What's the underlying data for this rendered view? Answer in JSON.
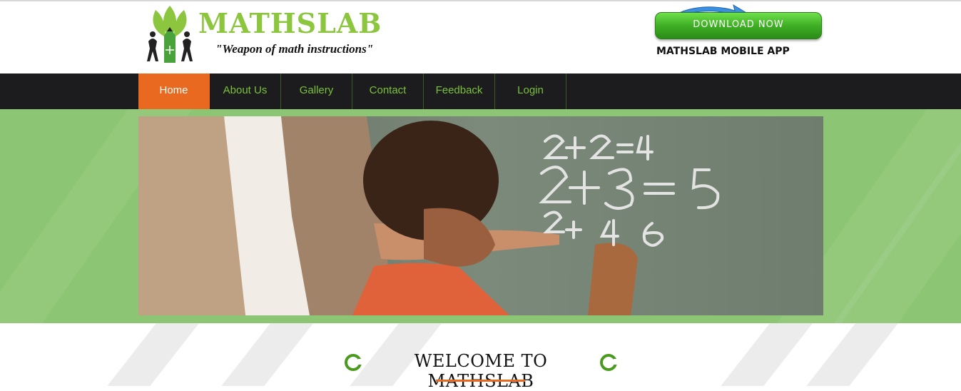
{
  "header": {
    "brand_name": "MATHSLAB",
    "tagline": "\"Weapon of math instructions\"",
    "download_label": "DOWNLOAD NOW",
    "app_label": "MATHSLAB MOBILE APP"
  },
  "nav": {
    "items": [
      {
        "label": "Home",
        "active": true
      },
      {
        "label": "About Us",
        "active": false
      },
      {
        "label": "Gallery",
        "active": false
      },
      {
        "label": "Contact",
        "active": false
      },
      {
        "label": "Feedback",
        "active": false
      },
      {
        "label": "Login",
        "active": false
      }
    ]
  },
  "hero": {
    "chalkboard": [
      "2+2=4",
      "2+3=5",
      "2+4=6"
    ]
  },
  "welcome": {
    "title": "WELCOME TO MATHSLAB"
  },
  "colors": {
    "brand_green": "#8cc63f",
    "nav_bg": "#1c1c1e",
    "active_orange": "#e8691f",
    "hero_band": "#8cc573"
  }
}
